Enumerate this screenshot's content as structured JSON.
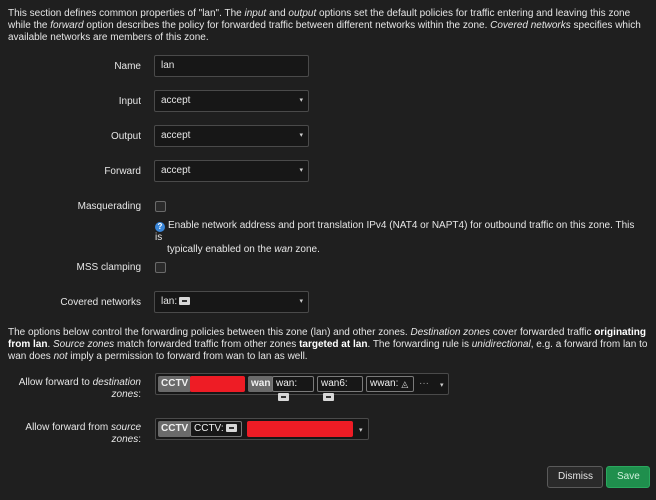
{
  "intro": {
    "t1": "This section defines common properties of \"lan\". The ",
    "input_word": "input",
    "t2": " and ",
    "output_word": "output",
    "t3": " options set the default policies for traffic entering and leaving this zone while the ",
    "forward_word": "forward",
    "t4": " option describes the policy for forwarded traffic between different networks within the zone. ",
    "covered_word": "Covered networks",
    "t5": " specifies which available networks are members of this zone."
  },
  "form": {
    "name_label": "Name",
    "name_value": "lan",
    "input_label": "Input",
    "input_value": "accept",
    "output_label": "Output",
    "output_value": "accept",
    "forward_label": "Forward",
    "forward_value": "accept",
    "masq_label": "Masquerading",
    "masq_help_1": "Enable network address and port translation IPv4 (NAT4 or NAPT4) for outbound traffic on this zone. This is",
    "masq_help_2a": "typically enabled on the ",
    "masq_help_wan": "wan",
    "masq_help_2b": " zone.",
    "mss_label": "MSS clamping",
    "covered_label": "Covered networks",
    "covered_value": "lan:",
    "caret": "▾"
  },
  "forwarding": {
    "t1": "The options below control the forwarding policies between this zone (lan) and other zones. ",
    "dest_word": "Destination zones",
    "t2": " cover forwarded traffic ",
    "orig_bold": "originating from lan",
    "t3": ". ",
    "src_word": "Source zones",
    "t4": " match forwarded traffic from other zones ",
    "target_bold": "targeted at lan",
    "t5": ". The forwarding rule is ",
    "unidir_word": "unidirectional",
    "t6": ", e.g. a forward from lan to wan does ",
    "not_word": "not",
    "t7": " imply a permission to forward from wan to lan as well.",
    "dest_label_a": "Allow forward to ",
    "dest_label_b": "destination",
    "dest_label_c": "zones",
    "dest_label_d": ":",
    "src_label_a": "Allow forward from ",
    "src_label_b": "source",
    "src_label_c": "zones",
    "src_label_d": ":",
    "dest_chips": {
      "cctv": "CCTV",
      "wan_zone": "wan",
      "wan": "wan:",
      "wan6": "wan6:",
      "wwan": "wwan:",
      "more": "···"
    },
    "src_chips": {
      "cctv": "CCTV",
      "cctv_net": "CCTV:"
    }
  },
  "buttons": {
    "dismiss": "Dismiss",
    "save": "Save"
  }
}
